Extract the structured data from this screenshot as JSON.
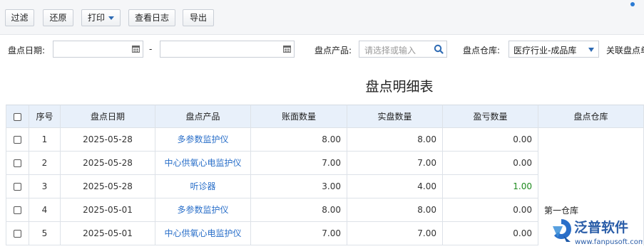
{
  "toolbar": {
    "filter_label": "过滤",
    "restore_label": "还原",
    "print_label": "打印",
    "log_label": "查看日志",
    "export_label": "导出"
  },
  "filters": {
    "date_label": "盘点日期:",
    "date_from": "",
    "date_to": "",
    "date_separator": "-",
    "product_label": "盘点产品:",
    "product_placeholder": "请选择或输入",
    "warehouse_label": "盘点仓库:",
    "warehouse_value": "医疗行业-成品库",
    "related_label": "关联盘点单"
  },
  "report": {
    "title": "盘点明细表"
  },
  "table": {
    "headers": [
      "序号",
      "盘点日期",
      "盘点产品",
      "账面数量",
      "实盘数量",
      "盈亏数量",
      "盘点仓库"
    ],
    "rows": [
      {
        "no": "1",
        "date": "2025-05-28",
        "product": "多参数监护仪",
        "book_qty": "8.00",
        "actual_qty": "8.00",
        "diff_qty": "0.00",
        "diff_status": "zero"
      },
      {
        "no": "2",
        "date": "2025-05-28",
        "product": "中心供氧心电监护仪",
        "book_qty": "7.00",
        "actual_qty": "7.00",
        "diff_qty": "0.00",
        "diff_status": "zero"
      },
      {
        "no": "3",
        "date": "2025-05-28",
        "product": "听诊器",
        "book_qty": "3.00",
        "actual_qty": "4.00",
        "diff_qty": "1.00",
        "diff_status": "positive"
      },
      {
        "no": "4",
        "date": "2025-05-01",
        "product": "多参数监护仪",
        "book_qty": "8.00",
        "actual_qty": "8.00",
        "diff_qty": "0.00",
        "diff_status": "zero"
      },
      {
        "no": "5",
        "date": "2025-05-01",
        "product": "中心供氧心电监护仪",
        "book_qty": "7.00",
        "actual_qty": "7.00",
        "diff_qty": "0.00",
        "diff_status": "zero"
      }
    ],
    "warehouse_group": "第一仓库"
  },
  "logo": {
    "name": "泛普软件",
    "url": "www.fanpusoft.com"
  },
  "colors": {
    "link": "#2a6fc9",
    "positive": "#1d8a1d",
    "header_bg": "#e8f0fa",
    "accent": "#2d6ab3"
  },
  "icons": [
    "calendar-icon",
    "search-icon",
    "chevron-down-icon",
    "checkbox-icon"
  ]
}
